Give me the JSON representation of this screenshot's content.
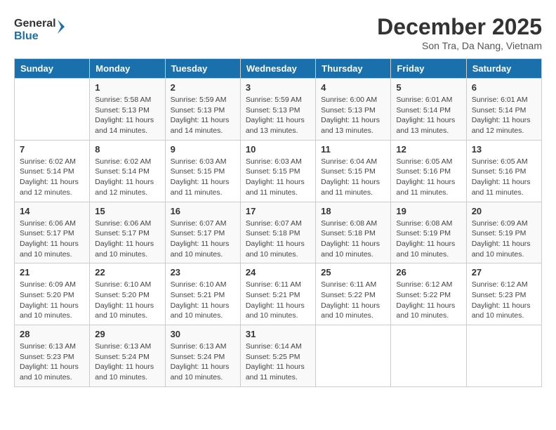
{
  "header": {
    "logo_general": "General",
    "logo_blue": "Blue",
    "month_title": "December 2025",
    "location": "Son Tra, Da Nang, Vietnam"
  },
  "calendar": {
    "days_of_week": [
      "Sunday",
      "Monday",
      "Tuesday",
      "Wednesday",
      "Thursday",
      "Friday",
      "Saturday"
    ],
    "weeks": [
      [
        {
          "day": "",
          "sunrise": "",
          "sunset": "",
          "daylight": ""
        },
        {
          "day": "1",
          "sunrise": "Sunrise: 5:58 AM",
          "sunset": "Sunset: 5:13 PM",
          "daylight": "Daylight: 11 hours and 14 minutes."
        },
        {
          "day": "2",
          "sunrise": "Sunrise: 5:59 AM",
          "sunset": "Sunset: 5:13 PM",
          "daylight": "Daylight: 11 hours and 14 minutes."
        },
        {
          "day": "3",
          "sunrise": "Sunrise: 5:59 AM",
          "sunset": "Sunset: 5:13 PM",
          "daylight": "Daylight: 11 hours and 13 minutes."
        },
        {
          "day": "4",
          "sunrise": "Sunrise: 6:00 AM",
          "sunset": "Sunset: 5:13 PM",
          "daylight": "Daylight: 11 hours and 13 minutes."
        },
        {
          "day": "5",
          "sunrise": "Sunrise: 6:01 AM",
          "sunset": "Sunset: 5:14 PM",
          "daylight": "Daylight: 11 hours and 13 minutes."
        },
        {
          "day": "6",
          "sunrise": "Sunrise: 6:01 AM",
          "sunset": "Sunset: 5:14 PM",
          "daylight": "Daylight: 11 hours and 12 minutes."
        }
      ],
      [
        {
          "day": "7",
          "sunrise": "Sunrise: 6:02 AM",
          "sunset": "Sunset: 5:14 PM",
          "daylight": "Daylight: 11 hours and 12 minutes."
        },
        {
          "day": "8",
          "sunrise": "Sunrise: 6:02 AM",
          "sunset": "Sunset: 5:14 PM",
          "daylight": "Daylight: 11 hours and 12 minutes."
        },
        {
          "day": "9",
          "sunrise": "Sunrise: 6:03 AM",
          "sunset": "Sunset: 5:15 PM",
          "daylight": "Daylight: 11 hours and 11 minutes."
        },
        {
          "day": "10",
          "sunrise": "Sunrise: 6:03 AM",
          "sunset": "Sunset: 5:15 PM",
          "daylight": "Daylight: 11 hours and 11 minutes."
        },
        {
          "day": "11",
          "sunrise": "Sunrise: 6:04 AM",
          "sunset": "Sunset: 5:15 PM",
          "daylight": "Daylight: 11 hours and 11 minutes."
        },
        {
          "day": "12",
          "sunrise": "Sunrise: 6:05 AM",
          "sunset": "Sunset: 5:16 PM",
          "daylight": "Daylight: 11 hours and 11 minutes."
        },
        {
          "day": "13",
          "sunrise": "Sunrise: 6:05 AM",
          "sunset": "Sunset: 5:16 PM",
          "daylight": "Daylight: 11 hours and 11 minutes."
        }
      ],
      [
        {
          "day": "14",
          "sunrise": "Sunrise: 6:06 AM",
          "sunset": "Sunset: 5:17 PM",
          "daylight": "Daylight: 11 hours and 10 minutes."
        },
        {
          "day": "15",
          "sunrise": "Sunrise: 6:06 AM",
          "sunset": "Sunset: 5:17 PM",
          "daylight": "Daylight: 11 hours and 10 minutes."
        },
        {
          "day": "16",
          "sunrise": "Sunrise: 6:07 AM",
          "sunset": "Sunset: 5:17 PM",
          "daylight": "Daylight: 11 hours and 10 minutes."
        },
        {
          "day": "17",
          "sunrise": "Sunrise: 6:07 AM",
          "sunset": "Sunset: 5:18 PM",
          "daylight": "Daylight: 11 hours and 10 minutes."
        },
        {
          "day": "18",
          "sunrise": "Sunrise: 6:08 AM",
          "sunset": "Sunset: 5:18 PM",
          "daylight": "Daylight: 11 hours and 10 minutes."
        },
        {
          "day": "19",
          "sunrise": "Sunrise: 6:08 AM",
          "sunset": "Sunset: 5:19 PM",
          "daylight": "Daylight: 11 hours and 10 minutes."
        },
        {
          "day": "20",
          "sunrise": "Sunrise: 6:09 AM",
          "sunset": "Sunset: 5:19 PM",
          "daylight": "Daylight: 11 hours and 10 minutes."
        }
      ],
      [
        {
          "day": "21",
          "sunrise": "Sunrise: 6:09 AM",
          "sunset": "Sunset: 5:20 PM",
          "daylight": "Daylight: 11 hours and 10 minutes."
        },
        {
          "day": "22",
          "sunrise": "Sunrise: 6:10 AM",
          "sunset": "Sunset: 5:20 PM",
          "daylight": "Daylight: 11 hours and 10 minutes."
        },
        {
          "day": "23",
          "sunrise": "Sunrise: 6:10 AM",
          "sunset": "Sunset: 5:21 PM",
          "daylight": "Daylight: 11 hours and 10 minutes."
        },
        {
          "day": "24",
          "sunrise": "Sunrise: 6:11 AM",
          "sunset": "Sunset: 5:21 PM",
          "daylight": "Daylight: 11 hours and 10 minutes."
        },
        {
          "day": "25",
          "sunrise": "Sunrise: 6:11 AM",
          "sunset": "Sunset: 5:22 PM",
          "daylight": "Daylight: 11 hours and 10 minutes."
        },
        {
          "day": "26",
          "sunrise": "Sunrise: 6:12 AM",
          "sunset": "Sunset: 5:22 PM",
          "daylight": "Daylight: 11 hours and 10 minutes."
        },
        {
          "day": "27",
          "sunrise": "Sunrise: 6:12 AM",
          "sunset": "Sunset: 5:23 PM",
          "daylight": "Daylight: 11 hours and 10 minutes."
        }
      ],
      [
        {
          "day": "28",
          "sunrise": "Sunrise: 6:13 AM",
          "sunset": "Sunset: 5:23 PM",
          "daylight": "Daylight: 11 hours and 10 minutes."
        },
        {
          "day": "29",
          "sunrise": "Sunrise: 6:13 AM",
          "sunset": "Sunset: 5:24 PM",
          "daylight": "Daylight: 11 hours and 10 minutes."
        },
        {
          "day": "30",
          "sunrise": "Sunrise: 6:13 AM",
          "sunset": "Sunset: 5:24 PM",
          "daylight": "Daylight: 11 hours and 10 minutes."
        },
        {
          "day": "31",
          "sunrise": "Sunrise: 6:14 AM",
          "sunset": "Sunset: 5:25 PM",
          "daylight": "Daylight: 11 hours and 11 minutes."
        },
        {
          "day": "",
          "sunrise": "",
          "sunset": "",
          "daylight": ""
        },
        {
          "day": "",
          "sunrise": "",
          "sunset": "",
          "daylight": ""
        },
        {
          "day": "",
          "sunrise": "",
          "sunset": "",
          "daylight": ""
        }
      ]
    ]
  }
}
